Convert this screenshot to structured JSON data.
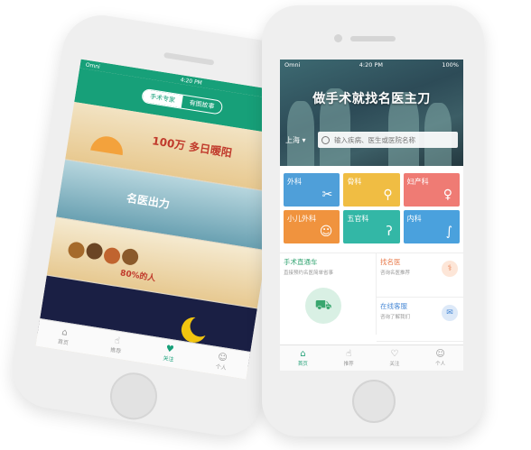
{
  "back_phone": {
    "status": {
      "carrier": "Omni",
      "time": "4:20 PM"
    },
    "segments": [
      "手术专家",
      "有图故事"
    ],
    "banners": [
      {
        "text": "100万 多日暖阳"
      },
      {
        "text": "名医出力"
      },
      {
        "text": "80%的人"
      },
      {
        "text": ""
      }
    ],
    "tabs": [
      {
        "label": "首页",
        "icon": "home-icon"
      },
      {
        "label": "推荐",
        "icon": "thumb-icon"
      },
      {
        "label": "关注",
        "icon": "heart-icon"
      },
      {
        "label": "个人",
        "icon": "user-icon"
      }
    ]
  },
  "front_phone": {
    "status": {
      "carrier": "Omni",
      "time": "4:20 PM",
      "battery": "100%"
    },
    "hero_title": "做手术就找名医主刀",
    "city": "上海",
    "search_placeholder": "输入疾病、医生或医院名称",
    "departments": [
      {
        "label": "外科",
        "icon": "scissors-icon",
        "color": "#4f9fd9"
      },
      {
        "label": "骨科",
        "icon": "bone-icon",
        "color": "#f0bd43"
      },
      {
        "label": "妇产科",
        "icon": "pregnant-icon",
        "color": "#ef7b74"
      },
      {
        "label": "小儿外科",
        "icon": "baby-icon",
        "color": "#f0933e"
      },
      {
        "label": "五官科",
        "icon": "ear-icon",
        "color": "#33b7a6"
      },
      {
        "label": "内科",
        "icon": "stomach-icon",
        "color": "#4aa1dd"
      }
    ],
    "cards": {
      "main": {
        "title": "手术直通车",
        "subtitle": "直接预约名医简单省事"
      },
      "doctor": {
        "title": "找名医",
        "subtitle": "咨询名医推荐"
      },
      "service": {
        "title": "在线客服",
        "subtitle": "咨询了解我们"
      }
    },
    "tabs": [
      {
        "label": "首页",
        "icon": "home-icon"
      },
      {
        "label": "推荐",
        "icon": "thumb-icon"
      },
      {
        "label": "关注",
        "icon": "heart-icon"
      },
      {
        "label": "个人",
        "icon": "user-icon"
      }
    ]
  },
  "colors": {
    "green": "#17a079",
    "accent": "#27a27a"
  }
}
